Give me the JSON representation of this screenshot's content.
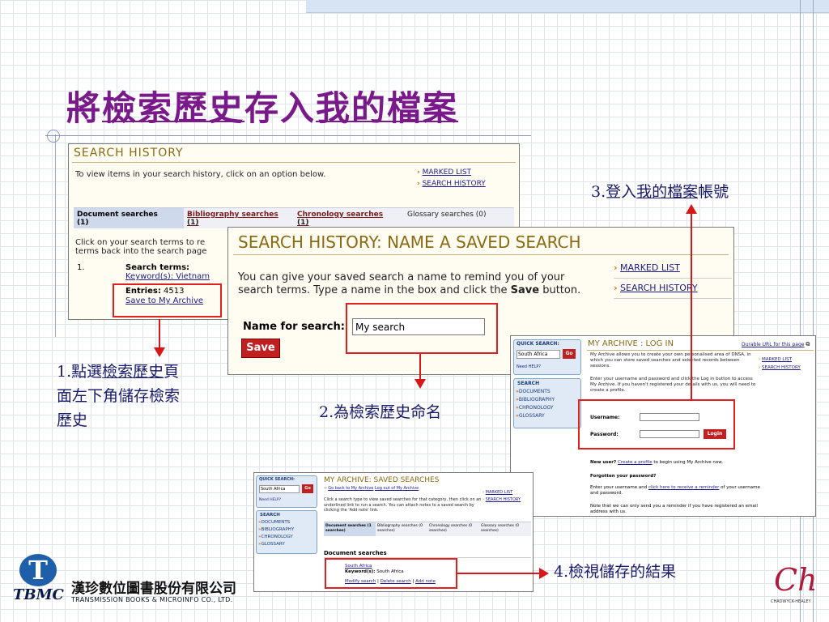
{
  "slide": {
    "title_pre": "將",
    "title_u1": "檢索歷史",
    "title_mid": "存入",
    "title_u2": "我的檔案"
  },
  "panel1": {
    "header": "SEARCH HISTORY",
    "intro": "To view items in your search history, click on an option below.",
    "links": [
      "MARKED LIST",
      "SEARCH HISTORY"
    ],
    "tabs": [
      {
        "name": "Document searches",
        "count": "(1)"
      },
      {
        "name": "Bibliography searches",
        "count": "(1)"
      },
      {
        "name": "Chronology searches",
        "count": "(1)"
      },
      {
        "name": "Glossary searches (0)",
        "count": ""
      }
    ],
    "click_text": "Click on your search terms to re",
    "click_text2": "terms back into the search page",
    "row_num": "1.",
    "search_terms_label": "Search terms:",
    "keyword": "Keyword(s): Vietnam",
    "entries_label": "Entries:",
    "entries_value": "4513",
    "save_link": "Save to My Archive"
  },
  "panel2": {
    "header": "SEARCH HISTORY: NAME A SAVED SEARCH",
    "intro1": "You can give your saved search a name to remind you of your",
    "intro2_pre": "search terms. Type a name in the box and click the ",
    "intro2_bold": "Save",
    "intro2_post": " button.",
    "links": [
      "MARKED LIST",
      "SEARCH HISTORY"
    ],
    "name_label": "Name for search:",
    "name_value": "My search",
    "save_button": "Save"
  },
  "panel3": {
    "quick_search": "QUICK SEARCH:",
    "search_value": "South Africa",
    "go": "Go",
    "need_help": "Need HELP?",
    "nav_title": "SEARCH",
    "nav": [
      "DOCUMENTS",
      "BIBLIOGRAPHY",
      "CHRONOLOGY",
      "GLOSSARY"
    ],
    "header": "MY ARCHIVE : LOG IN",
    "durable": "Durable URL for this page",
    "intro": "My Archive allows you to create your own personalised area of DNSA, in which you can store saved searches and selected records between sessions.",
    "links": [
      "MARKED LIST",
      "SEARCH HISTORY"
    ],
    "login_intro": "Enter your username and password and click the Log in button to access My Archive. If you haven't registered your details with us, you will need to create a profile.",
    "username_label": "Username:",
    "password_label": "Password:",
    "login_button": "Login",
    "new_user_pre": "New user? ",
    "new_user_link": "Create a profile",
    "new_user_post": " to begin using My Archive now.",
    "forgot": "Forgotten your password?",
    "reminder_pre": "Enter your username and ",
    "reminder_link": "click here to receive a reminder",
    "reminder_post": " of your username and password.",
    "note": "Note that we can only send you a reminder if you have registered an email address with us."
  },
  "panel4": {
    "quick_search": "QUICK SEARCH:",
    "search_value": "South Africa",
    "go": "Go",
    "need_help": "Need HELP?",
    "nav_title": "SEARCH",
    "nav": [
      "DOCUMENTS",
      "BIBLIOGRAPHY",
      "CHRONOLOGY",
      "GLOSSARY"
    ],
    "header": "MY ARCHIVE: SAVED SEARCHES",
    "back_link": "Go back to My Archive",
    "logout_link": "Log out of My Archive",
    "intro": "Click a search type to view saved searches for that category, then click on an underlined link to run a search. You can attach notes to a saved search by clicking the 'Add note' link.",
    "links": [
      "MARKED LIST",
      "SEARCH HISTORY"
    ],
    "tabs": [
      "Document searches (1 searches)",
      "Bibliography searches (0 searches)",
      "Chronology searches (0 searches)",
      "Glossary searches (0 searches)"
    ],
    "section": "Document searches",
    "result_link": "South Africa",
    "result_keyword_label": "Keyword(s):",
    "result_keyword": "South Africa",
    "actions": [
      "Modify search",
      "Delete search",
      "Add note"
    ]
  },
  "callouts": {
    "c1_num": "1.",
    "c1_a": "點選",
    "c1_u": "檢索歷史",
    "c1_b": "頁",
    "c1_line2": "面左下角儲存檢索",
    "c1_line3": "歷史",
    "c2": "2.為檢索歷史命名",
    "c3_pre": "3.登入",
    "c3_u": "我的檔案",
    "c3_post": "帳號",
    "c4": "4.檢視儲存的結果"
  },
  "footer": {
    "logo_letter": "T",
    "logo_text": "TBMC",
    "company_cn": "漢珍數位圖書股份有限公司",
    "company_en": "TRANSMISSION BOOKS & MICROINFO CO., LTD.",
    "right_logo": "Ch",
    "right_text": "CHADWYCK-HEALEY"
  },
  "colors": {
    "title": "#7a1a8a",
    "callout": "#1a1a6a",
    "red": "#e02020",
    "header_gold": "#8a6a12",
    "link": "#1a1a8a",
    "tbmc_blue": "#1f5ea8"
  }
}
